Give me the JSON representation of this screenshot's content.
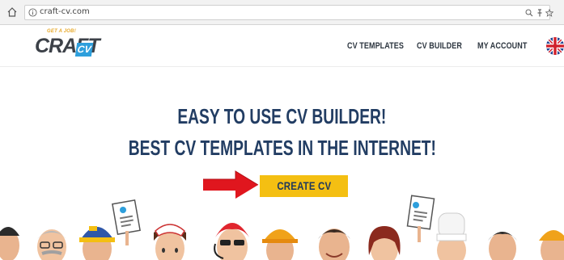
{
  "browser": {
    "url": "craft-cv.com",
    "icons": [
      "home-icon",
      "info-icon",
      "zoom-icon",
      "pin-icon",
      "star-icon"
    ]
  },
  "site": {
    "logo": {
      "tagline": "GET A JOB!",
      "word": "CRAFT",
      "badge": "CV"
    },
    "nav": [
      {
        "label": "CV TEMPLATES"
      },
      {
        "label": "CV BUILDER"
      },
      {
        "label": "MY ACCOUNT"
      }
    ],
    "language_flag": "uk-flag-icon"
  },
  "hero": {
    "line1": "EASY TO USE CV BUILDER!",
    "line2": "BEST CV TEMPLATES IN THE INTERNET!",
    "cta_label": "CREATE CV"
  },
  "colors": {
    "heading": "#223d63",
    "cta_bg": "#f4bf12",
    "arrow": "#e0161e",
    "logo_accent": "#2e9fdc"
  }
}
